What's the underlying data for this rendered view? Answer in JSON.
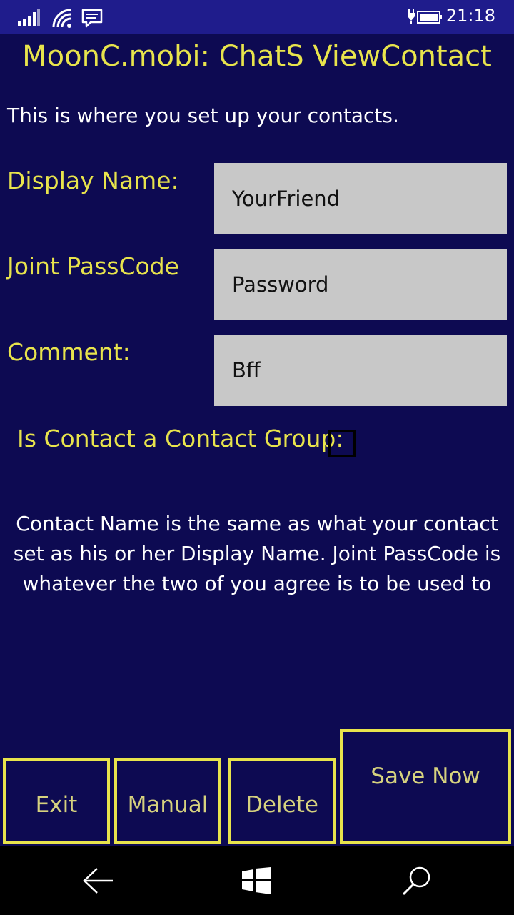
{
  "status_bar": {
    "icons": [
      "signal-icon",
      "wifi-icon",
      "message-icon",
      "battery-charging-icon"
    ],
    "time": "21:18"
  },
  "app": {
    "title": "MoonC.mobi: ChatS ViewContact"
  },
  "intro": "This is where you set up your contacts.",
  "form": {
    "display_name": {
      "label": "Display Name:",
      "value": "YourFriend"
    },
    "joint_passcode": {
      "label": "Joint PassCode",
      "value": "Password"
    },
    "comment": {
      "label": "Comment:",
      "value": "Bff"
    },
    "contact_group": {
      "label": "Is Contact a Contact Group:",
      "checked": false
    }
  },
  "help_lines": [
    "Contact Name is the same as what your contact",
    "set as his or her Display Name. Joint PassCode is",
    "whatever the two of you agree is to be used to"
  ],
  "buttons": {
    "exit": "Exit",
    "manual": "Manual",
    "delete": "Delete",
    "save_now": "Save Now"
  },
  "nav_bar": {
    "icons": [
      "back-arrow-icon",
      "windows-start-icon",
      "search-icon"
    ]
  },
  "colors": {
    "background": "#0d0a52",
    "status_bar": "#1f1c8c",
    "accent_yellow": "#e8e44c",
    "field_bg": "#c8c8c8",
    "nav_bar": "#000000"
  }
}
